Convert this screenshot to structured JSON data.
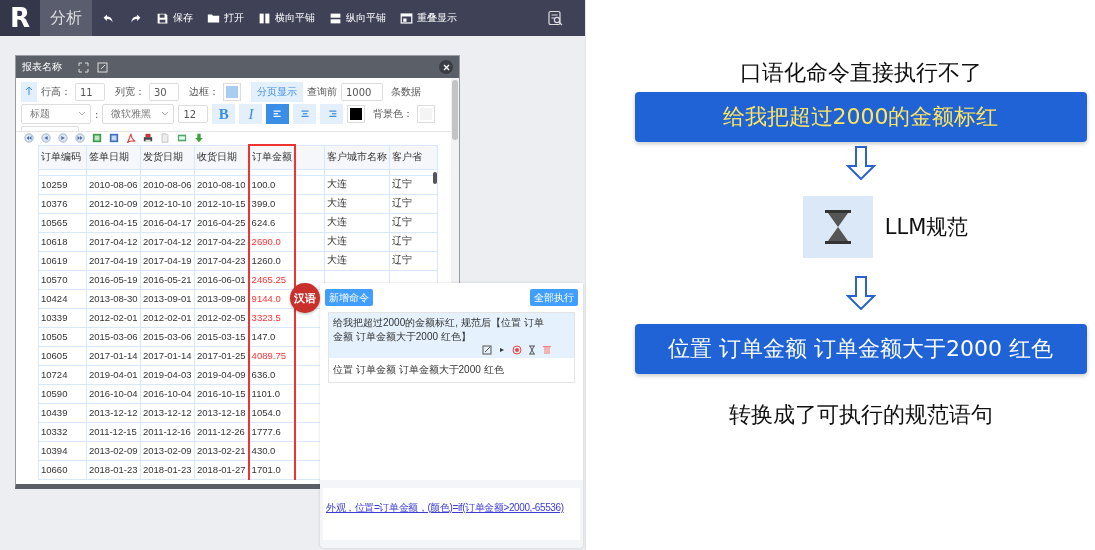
{
  "app_bar": {
    "logo": "R",
    "tabs": [
      {
        "label": "分析",
        "selected": true
      }
    ],
    "tools": [
      {
        "kind": "undo"
      },
      {
        "kind": "redo"
      },
      {
        "kind": "save",
        "label": "保存"
      },
      {
        "kind": "open",
        "label": "打开"
      },
      {
        "kind": "tile_h",
        "label": "横向平铺"
      },
      {
        "kind": "tile_v",
        "label": "纵向平铺"
      },
      {
        "kind": "cascade",
        "label": "重叠显示"
      }
    ]
  },
  "report_dialog": {
    "title": "报表名称",
    "toolbar": {
      "row_height": {
        "label": "行高：",
        "value": "11"
      },
      "col_width": {
        "label": "列宽：",
        "value": "30"
      },
      "border_label": "边框：",
      "page_button": "分页显示",
      "query_prefix": "查询前",
      "query_value": "1000",
      "query_suffix": "条数据",
      "title_select": "标题",
      "colon": ":",
      "font_select": "微软雅黑",
      "font_size": "12",
      "bold": "B",
      "italic": "I",
      "align": [
        {
          "kind": "left",
          "selected": true
        },
        {
          "kind": "center",
          "selected": false
        },
        {
          "kind": "right",
          "selected": false
        }
      ],
      "bg_label": "背景色："
    },
    "nav_icons": [
      {
        "kind": "first"
      },
      {
        "kind": "prev"
      },
      {
        "kind": "next"
      },
      {
        "kind": "last"
      },
      {
        "kind": "excel"
      },
      {
        "kind": "word"
      },
      {
        "kind": "pdf"
      },
      {
        "kind": "print"
      },
      {
        "kind": "file"
      },
      {
        "kind": "image"
      },
      {
        "kind": "download"
      }
    ],
    "table": {
      "columns": [
        {
          "label": "订单编码",
          "selected": false
        },
        {
          "label": "签单日期",
          "selected": false
        },
        {
          "label": "发货日期",
          "selected": false
        },
        {
          "label": "收货日期",
          "selected": false
        },
        {
          "label": "订单金额",
          "selected": true
        },
        {
          "selected": false
        },
        {
          "label": "客户城市名称",
          "selected": false
        },
        {
          "label": "客户省",
          "selected": false
        }
      ],
      "rows": [
        {
          "cells": [
            "10259",
            "2010-08-06",
            "2010-08-06",
            "2010-08-10",
            "100.0",
            "",
            "大连",
            "辽宁"
          ],
          "highlighted": false
        },
        {
          "cells": [
            "10376",
            "2012-10-09",
            "2012-10-10",
            "2012-10-15",
            "399.0",
            "",
            "大连",
            "辽宁"
          ],
          "highlighted": false
        },
        {
          "cells": [
            "10565",
            "2016-04-15",
            "2016-04-17",
            "2016-04-25",
            "624.6",
            "",
            "大连",
            "辽宁"
          ],
          "highlighted": false
        },
        {
          "cells": [
            "10618",
            "2017-04-12",
            "2017-04-12",
            "2017-04-22",
            "2690.0",
            "",
            "大连",
            "辽宁"
          ],
          "highlighted": true
        },
        {
          "cells": [
            "10619",
            "2017-04-19",
            "2017-04-19",
            "2017-04-23",
            "1260.0",
            "",
            "大连",
            "辽宁"
          ],
          "highlighted": false
        },
        {
          "cells": [
            "10570",
            "2016-05-19",
            "2016-05-21",
            "2016-06-01",
            "2465.25"
          ],
          "highlighted": true
        },
        {
          "cells": [
            "10424",
            "2013-08-30",
            "2013-09-01",
            "2013-09-08",
            "9144.0"
          ],
          "highlighted": true
        },
        {
          "cells": [
            "10339",
            "2012-02-01",
            "2012-02-01",
            "2012-02-05",
            "3323.5"
          ],
          "highlighted": true
        },
        {
          "cells": [
            "10505",
            "2015-03-06",
            "2015-03-06",
            "2015-03-15",
            "147.0"
          ],
          "highlighted": false
        },
        {
          "cells": [
            "10605",
            "2017-01-14",
            "2017-01-14",
            "2017-01-25",
            "4089.75"
          ],
          "highlighted": true
        },
        {
          "cells": [
            "10724",
            "2019-04-01",
            "2019-04-03",
            "2019-04-09",
            "636.0"
          ],
          "highlighted": false
        },
        {
          "cells": [
            "10590",
            "2016-10-04",
            "2016-10-04",
            "2016-10-15",
            "1101.0"
          ],
          "highlighted": false
        },
        {
          "cells": [
            "10439",
            "2013-12-12",
            "2013-12-12",
            "2013-12-18",
            "1054.0"
          ],
          "highlighted": false
        },
        {
          "cells": [
            "10332",
            "2011-12-15",
            "2011-12-16",
            "2011-12-26",
            "1777.6"
          ],
          "highlighted": false
        },
        {
          "cells": [
            "10394",
            "2013-02-09",
            "2013-02-09",
            "2013-02-21",
            "430.0"
          ],
          "highlighted": false
        },
        {
          "cells": [
            "10660",
            "2018-01-23",
            "2018-01-23",
            "2018-01-27",
            "1701.0"
          ],
          "highlighted": false
        }
      ]
    }
  },
  "command_panel": {
    "badge": "汉语",
    "add_button": "新增命令",
    "run_all_button": "全部执行",
    "commands": [
      {
        "text": "给我把超过2000的金额标红, 规范后【位置 订单金额 订单金额大于2000 红色】",
        "result": "位置 订单金额 订单金额大于2000 红色",
        "selected": true
      }
    ],
    "script": "外观，位置=订单金额，(颜色)=if(订单金额>2000,-65536)"
  },
  "explanation": {
    "heading": "口语化命令直接执行不了",
    "input": "给我把超过2000的金额标红",
    "step": "LLM规范",
    "output": "位置 订单金额 订单金额大于2000 红色",
    "caption": "转换成了可执行的规范语句"
  }
}
